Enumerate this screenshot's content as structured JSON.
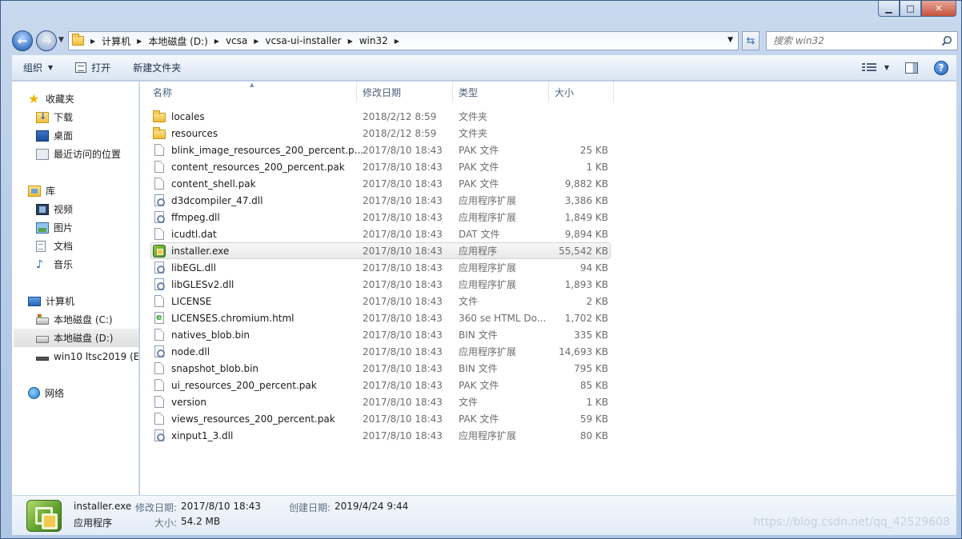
{
  "window": {
    "minimize": "▁",
    "maximize": "□",
    "close": "✕"
  },
  "address": {
    "crumbs": [
      "计算机",
      "本地磁盘 (D:)",
      "vcsa",
      "vcsa-ui-installer",
      "win32"
    ]
  },
  "search": {
    "placeholder": "搜索 win32"
  },
  "toolbar": {
    "organize": "组织",
    "open": "打开",
    "new_folder": "新建文件夹"
  },
  "sidebar": {
    "favorites": {
      "label": "收藏夹",
      "items": [
        "下载",
        "桌面",
        "最近访问的位置"
      ]
    },
    "libraries": {
      "label": "库",
      "items": [
        "视频",
        "图片",
        "文档",
        "音乐"
      ]
    },
    "computer": {
      "label": "计算机",
      "items": [
        "本地磁盘 (C:)",
        "本地磁盘 (D:)",
        "win10 ltsc2019 (E:)"
      ]
    },
    "network": {
      "label": "网络"
    }
  },
  "columns": {
    "name": "名称",
    "date": "修改日期",
    "type": "类型",
    "size": "大小"
  },
  "files": [
    {
      "name": "locales",
      "date": "2018/2/12 8:59",
      "type": "文件夹",
      "size": "",
      "icon": "folder"
    },
    {
      "name": "resources",
      "date": "2018/2/12 8:59",
      "type": "文件夹",
      "size": "",
      "icon": "folder"
    },
    {
      "name": "blink_image_resources_200_percent.p...",
      "date": "2017/8/10 18:43",
      "type": "PAK 文件",
      "size": "25 KB",
      "icon": "file"
    },
    {
      "name": "content_resources_200_percent.pak",
      "date": "2017/8/10 18:43",
      "type": "PAK 文件",
      "size": "1 KB",
      "icon": "file"
    },
    {
      "name": "content_shell.pak",
      "date": "2017/8/10 18:43",
      "type": "PAK 文件",
      "size": "9,882 KB",
      "icon": "file"
    },
    {
      "name": "d3dcompiler_47.dll",
      "date": "2017/8/10 18:43",
      "type": "应用程序扩展",
      "size": "3,386 KB",
      "icon": "dll"
    },
    {
      "name": "ffmpeg.dll",
      "date": "2017/8/10 18:43",
      "type": "应用程序扩展",
      "size": "1,849 KB",
      "icon": "dll"
    },
    {
      "name": "icudtl.dat",
      "date": "2017/8/10 18:43",
      "type": "DAT 文件",
      "size": "9,894 KB",
      "icon": "file"
    },
    {
      "name": "installer.exe",
      "date": "2017/8/10 18:43",
      "type": "应用程序",
      "size": "55,542 KB",
      "icon": "exe",
      "selected": true
    },
    {
      "name": "libEGL.dll",
      "date": "2017/8/10 18:43",
      "type": "应用程序扩展",
      "size": "94 KB",
      "icon": "dll"
    },
    {
      "name": "libGLESv2.dll",
      "date": "2017/8/10 18:43",
      "type": "应用程序扩展",
      "size": "1,893 KB",
      "icon": "dll"
    },
    {
      "name": "LICENSE",
      "date": "2017/8/10 18:43",
      "type": "文件",
      "size": "2 KB",
      "icon": "file"
    },
    {
      "name": "LICENSES.chromium.html",
      "date": "2017/8/10 18:43",
      "type": "360 se HTML Do...",
      "size": "1,702 KB",
      "icon": "html"
    },
    {
      "name": "natives_blob.bin",
      "date": "2017/8/10 18:43",
      "type": "BIN 文件",
      "size": "335 KB",
      "icon": "file"
    },
    {
      "name": "node.dll",
      "date": "2017/8/10 18:43",
      "type": "应用程序扩展",
      "size": "14,693 KB",
      "icon": "dll"
    },
    {
      "name": "snapshot_blob.bin",
      "date": "2017/8/10 18:43",
      "type": "BIN 文件",
      "size": "795 KB",
      "icon": "file"
    },
    {
      "name": "ui_resources_200_percent.pak",
      "date": "2017/8/10 18:43",
      "type": "PAK 文件",
      "size": "85 KB",
      "icon": "file"
    },
    {
      "name": "version",
      "date": "2017/8/10 18:43",
      "type": "文件",
      "size": "1 KB",
      "icon": "file"
    },
    {
      "name": "views_resources_200_percent.pak",
      "date": "2017/8/10 18:43",
      "type": "PAK 文件",
      "size": "59 KB",
      "icon": "file"
    },
    {
      "name": "xinput1_3.dll",
      "date": "2017/8/10 18:43",
      "type": "应用程序扩展",
      "size": "80 KB",
      "icon": "dll"
    }
  ],
  "details": {
    "name": "installer.exe",
    "type": "应用程序",
    "modified_label": "修改日期:",
    "modified": "2017/8/10 18:43",
    "created_label": "创建日期:",
    "created": "2019/4/24 9:44",
    "size_label": "大小:",
    "size": "54.2 MB"
  },
  "watermark": "https://blog.csdn.net/qq_42529608"
}
